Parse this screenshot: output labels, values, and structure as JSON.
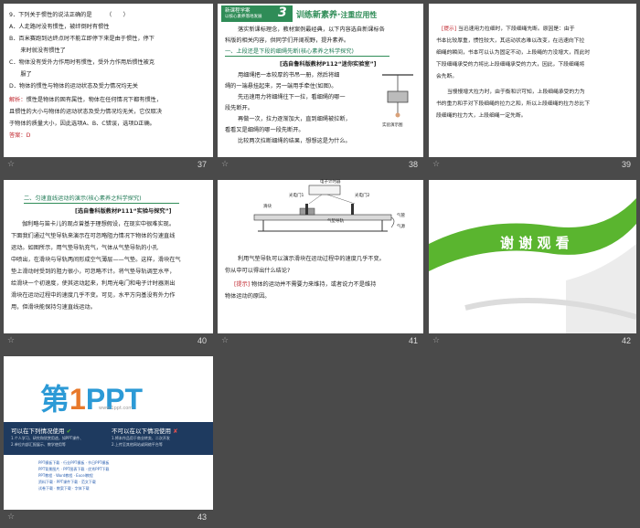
{
  "slides": {
    "s37": {
      "number": "37",
      "lines": [
        "9．下列关于惯性的说法正确的是　　　（　　）",
        "A．人走路时没有惯性，被绊倒时有惯性",
        "B．百米赛跑到达终点时不能立即停下来是由于惯性，停下",
        "　　来时就没有惯性了",
        "C．物体没有受外力作用时有惯性，受外力作用后惯性被克",
        "　　服了",
        "D．物体的惯性与物体的运动状态及受力情况均无关"
      ],
      "analysis_label": "解析：",
      "analysis_lines": [
        "惯性是物体的固有属性，物体在任何情况下都有惯性，",
        "且惯性的大小与物体的运动状态及受力情况均无关，它仅取决",
        "于物体的质量大小，因此选项A、B、C错误，选项D正确。"
      ],
      "answer_label": "答案：",
      "answer_value": "D"
    },
    "s38": {
      "number": "38",
      "banner_top": "新课程学案",
      "banner_sub": "以核心素养落地发展",
      "banner_num": "3",
      "banner_title": "训练新素养",
      "banner_sep": "·",
      "banner_title2": "注重应用性",
      "intro_lines": [
        "落实新课标理念，教材案例最经典，以下内容选自新课标各",
        "科版的相关内容，供同学们开阔视野，提升素养。"
      ],
      "heading": "一、上段还是下段的细绳先断(核心素养之科学探究)",
      "source": "[选自鲁科版教材P112“迷你实验室”]",
      "body_lines": [
        "用细绳把一本较厚的书吊一册，然后将细",
        "绳的一端悬挂起来，另一端用手牵住(如图)。",
        "先迅速用力将细绳往下一拉，看细绳的哪一",
        "段先断开。",
        "再做一次，拉力逐渐加大，直到细绳被拉断，",
        "看看又是细绳的哪一段先断开。",
        "比较两次拉断细绳的结果，想想这是为什么。"
      ],
      "figure_caption": "实验演示图"
    },
    "s39": {
      "number": "39",
      "hint_label": "[提示]",
      "hint_lines": [
        "当迅速用力拉细时，下段细绳先断。原因是：由于",
        "书本比较厚重，惯性较大，其运动状态难以改变，在迅速向下拉",
        "细绳的瞬间，书本可以认为固定不动，上段绳的力没增大，而此时",
        "下段细绳承受的力将比上段细绳承受的力大，因此，下段细绳将",
        "会先断。",
        "当慢慢增大拉力时，由于衡和识可知，上段细绳承受的力为",
        "书的重力和手对下段细绳的拉力之和，所以上段细绳的拉力总比下",
        "段细绳的拉力大，上段细绳一定先断。"
      ]
    },
    "s40": {
      "number": "40",
      "heading": "二、匀速直线运动的演示(核心素养之科学探究)",
      "source": "[选自鲁科版教材P111“实验与探究”]",
      "body_lines": [
        "伽利略与笛卡儿的观点曾基于理想假设，在现实中很难实现。",
        "下面我们通过气垫导轨来演示在可忽略阻力情况下物体的匀速直线",
        "运动。如图所示，用气垫导轨充气，气体从气垫导轨的小孔",
        "中喷出，在滑块与导轨两间形成空气薄层——气垫。这样，滑块在气",
        "垫上滑动时受到的阻力很小，可忽略不计。将气垫导轨调至水平，",
        "给滑块一个初速度，使其运动起来，利用光电门和电子计时器测出",
        "滑块在运动过程中的速度几乎不变。可见，水平方向基没有外力作",
        "用，但滑块能保持匀速直线运动。"
      ]
    },
    "s41": {
      "number": "41",
      "diagram_labels": {
        "timer": "电子计时器",
        "gate1": "光电门1",
        "gate2": "光电门2",
        "slider": "滑块",
        "track": "气垫导轨",
        "pipe": "气管",
        "airsource": "气源"
      },
      "body_lines": [
        "利用气垫导轨可以演示滑块在运动过程中的速度几乎不变。",
        "你从中可以得出什么结论?"
      ],
      "hint_label": "[提示]",
      "hint_lines": [
        "物体的运动并不需要力来维持，或者说力不是维持",
        "物体运动的原因。"
      ]
    },
    "s42": {
      "number": "42",
      "thanks": "谢 谢 观 看"
    },
    "s43": {
      "number": "43",
      "brand_a": "第",
      "brand_b": "1",
      "brand_c": "PPT",
      "brand_url": "www.1ppt.com",
      "can_title": "可以在下列情况使用",
      "cannot_title": "不可以在以下情况使用",
      "can_lines": [
        "1.个人学习、研究和欣赏用途，如PPT课件、",
        "2.单位内部汇报展示、教学使用等"
      ],
      "cannot_lines": [
        "1.将本作品用于商业转卖、二次开发",
        "2.上传至其他网站或网络平台等"
      ],
      "link_rows": [
        "PPT模板下载 · 行业PPT模板 · 节日PPT模板",
        "PPT背景图片 · PPT图表下载 · 优秀PPT下载",
        "PPT教程 · Word教程 · Excel教程",
        "资料下载 · PPT课件下载 · 范文下载",
        "试卷下载 · 教案下载 · 字体下载"
      ]
    }
  },
  "colors": {
    "background": "#4a4a4a",
    "green_accent": "#2f8c57",
    "red_text": "#c0262d",
    "thanks_green": "#5ab52f"
  }
}
